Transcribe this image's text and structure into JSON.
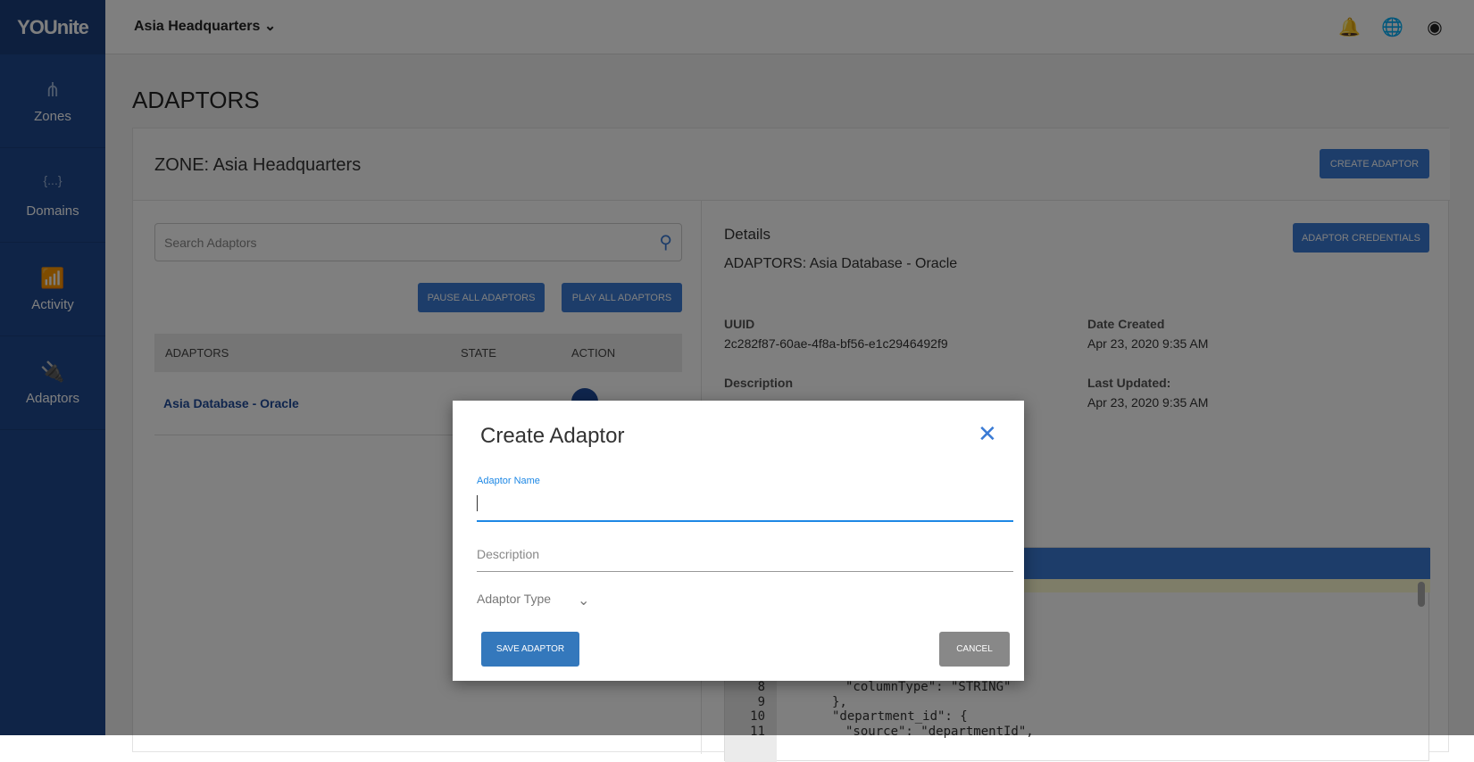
{
  "brand": "YOUnite",
  "sidebar": {
    "items": [
      {
        "label": "Zones",
        "icon": "hierarchy-icon"
      },
      {
        "label": "Domains",
        "icon": "braces-icon",
        "glyph": "{...}"
      },
      {
        "label": "Activity",
        "icon": "chart-icon"
      },
      {
        "label": "Adaptors",
        "icon": "plug-icon"
      }
    ]
  },
  "header": {
    "zone": "Asia Headquarters"
  },
  "page": {
    "title": "ADAPTORS",
    "zone_title": "ZONE: Asia Headquarters",
    "create_label": "CREATE ADAPTOR"
  },
  "left": {
    "search_placeholder": "Search Adaptors",
    "pause_label": "PAUSE ALL ADAPTORS",
    "play_label": "PLAY ALL ADAPTORS",
    "columns": [
      "ADAPTORS",
      "STATE",
      "ACTION"
    ],
    "rows": [
      {
        "name": "Asia Database - Oracle"
      }
    ]
  },
  "details": {
    "heading": "Details",
    "credentials_label": "ADAPTOR CREDENTIALS",
    "subtitle": "ADAPTORS: Asia Database - Oracle",
    "uuid_label": "UUID",
    "uuid": "2c282f87-60ae-4f8a-bf56-e1c2946492f9",
    "created_label": "Date Created",
    "created": "Apr 23, 2020 9:35 AM",
    "description_label": "Description",
    "updated_label": "Last Updated:",
    "updated": "Apr 23, 2020 9:35 AM"
  },
  "code": {
    "lines": [
      {
        "n": "8",
        "text": "\"columnType\": \"STRING\""
      },
      {
        "n": "9",
        "text": "},"
      },
      {
        "n": "10",
        "text": "\"department_id\": {"
      },
      {
        "n": "11",
        "text": "\"source\": \"departmentId\","
      }
    ]
  },
  "modal": {
    "title": "Create Adaptor",
    "name_label": "Adaptor Name",
    "name_value": "",
    "description_placeholder": "Description",
    "type_label": "Adaptor Type",
    "save_label": "SAVE ADAPTOR",
    "cancel_label": "CANCEL"
  },
  "colors": {
    "sidebar": "#1e488e",
    "primary": "#3a7bd5",
    "focus": "#1e88e5",
    "save": "#3478bc",
    "cancel": "#888888"
  }
}
